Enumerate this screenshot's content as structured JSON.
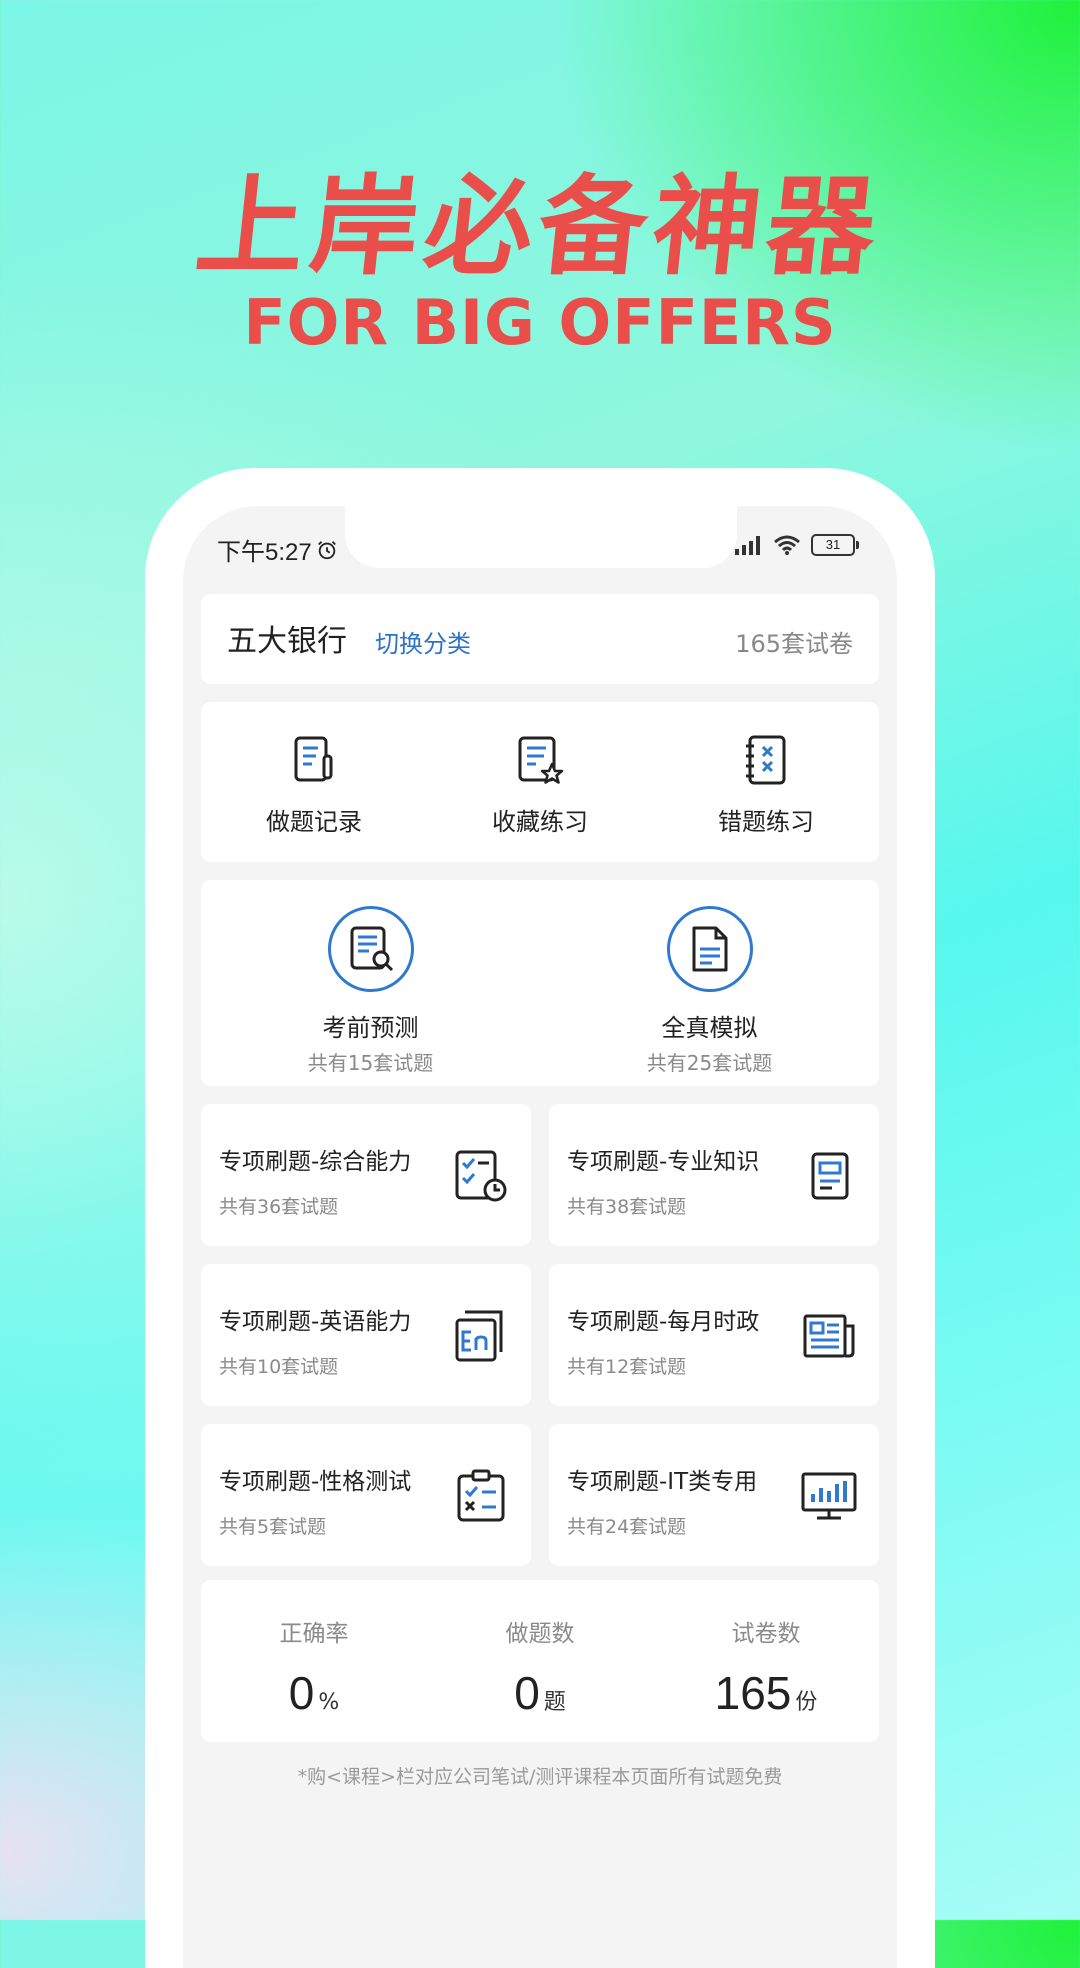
{
  "hero": {
    "title": "上岸必备神器",
    "subtitle": "FOR BIG OFFERS"
  },
  "status_bar": {
    "time": "下午5:27",
    "battery": "31"
  },
  "header": {
    "title": "五大银行",
    "switch_label": "切换分类",
    "count": "165套试卷"
  },
  "quick_actions": [
    {
      "label": "做题记录",
      "icon": "record-icon"
    },
    {
      "label": "收藏练习",
      "icon": "favorite-icon"
    },
    {
      "label": "错题练习",
      "icon": "wrong-questions-icon"
    }
  ],
  "mock_exams": [
    {
      "label": "考前预测",
      "sub": "共有15套试题",
      "icon": "search-document-icon"
    },
    {
      "label": "全真模拟",
      "sub": "共有25套试题",
      "icon": "document-icon"
    }
  ],
  "topics": [
    {
      "title": "专项刷题-综合能力",
      "sub": "共有36套试题",
      "icon": "checklist-clock-icon"
    },
    {
      "title": "专项刷题-专业知识",
      "sub": "共有38套试题",
      "icon": "book-icon"
    },
    {
      "title": "专项刷题-英语能力",
      "sub": "共有10套试题",
      "icon": "english-icon"
    },
    {
      "title": "专项刷题-每月时政",
      "sub": "共有12套试题",
      "icon": "newspaper-icon"
    },
    {
      "title": "专项刷题-性格测试",
      "sub": "共有5套试题",
      "icon": "clipboard-icon"
    },
    {
      "title": "专项刷题-IT类专用",
      "sub": "共有24套试题",
      "icon": "monitor-chart-icon"
    }
  ],
  "stats": [
    {
      "label": "正确率",
      "value": "0",
      "unit": "%"
    },
    {
      "label": "做题数",
      "value": "0",
      "unit": "题"
    },
    {
      "label": "试卷数",
      "value": "165",
      "unit": "份"
    }
  ],
  "footnote": "*购<课程>栏对应公司笔试/测评课程本页面所有试题免费",
  "colors": {
    "accent_red": "#ea4e4a",
    "link_blue": "#2c73c9",
    "icon_blue": "#2f79cf"
  }
}
